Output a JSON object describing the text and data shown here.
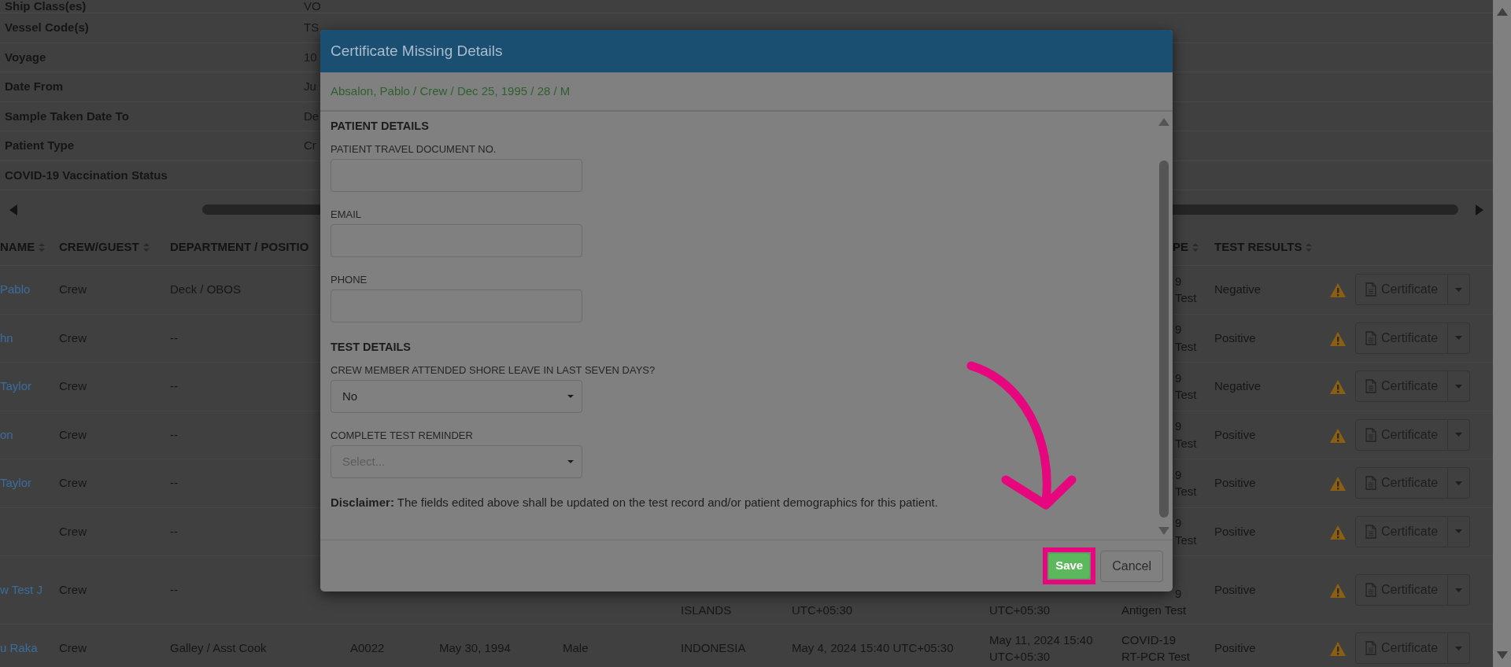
{
  "summary": [
    {
      "label": "Ship Class(es)",
      "value": "VO"
    },
    {
      "label": "Vessel Code(s)",
      "value": "TS"
    },
    {
      "label": "Voyage",
      "value": "10"
    },
    {
      "label": "Date From",
      "value": "Ju"
    },
    {
      "label": "Sample Taken Date To",
      "value": "De"
    },
    {
      "label": "Patient Type",
      "value": "Cr"
    },
    {
      "label": "COVID-19 Vaccination Status"
    }
  ],
  "table": {
    "columns": [
      {
        "label": "NAME",
        "sortable": true
      },
      {
        "label": "CREW/GUEST",
        "sortable": true
      },
      {
        "label": "DEPARTMENT / POSITIO",
        "sortable": false
      },
      {
        "label": "PE",
        "sortable": true
      },
      {
        "label": "TEST RESULTS",
        "sortable": true
      }
    ],
    "rows": [
      {
        "name": "Pablo",
        "crew_guest": "Crew",
        "department": "Deck / OBOS",
        "test_type": {
          "kind": "covered",
          "lines": [
            "9",
            "Test"
          ]
        },
        "test_results": "Negative",
        "button": "Certificate"
      },
      {
        "name": "hn",
        "crew_guest": "Crew",
        "department": "--",
        "test_type": {
          "kind": "covered",
          "lines": [
            "9",
            "Test"
          ]
        },
        "test_results": "Positive",
        "button": "Certificate"
      },
      {
        "name": "Taylor",
        "crew_guest": "Crew",
        "department": "--",
        "test_type": {
          "kind": "covered",
          "lines": [
            "9",
            "Test"
          ]
        },
        "test_results": "Negative",
        "button": "Certificate"
      },
      {
        "name": "on",
        "crew_guest": "Crew",
        "department": "--",
        "test_type": {
          "kind": "covered",
          "lines": [
            "9",
            "Test"
          ]
        },
        "test_results": "Positive",
        "button": "Certificate"
      },
      {
        "name": "Taylor",
        "crew_guest": "Crew",
        "department": "--",
        "test_type": {
          "kind": "covered",
          "lines": [
            "9",
            "Test"
          ]
        },
        "test_results": "Positive",
        "button": "Certificate"
      },
      {
        "crew_guest": "Crew",
        "department": "--",
        "test_type": {
          "kind": "covered",
          "lines": [
            "9",
            "Test"
          ]
        },
        "test_results": "Positive",
        "button": "Certificate"
      },
      {
        "kind": "partly_covered",
        "name": "w Test J",
        "crew_guest": "Crew",
        "department": "--",
        "column_7": "ISLANDS",
        "column_8": "UTC+05:30",
        "column_9": "UTC+05:30",
        "test_type": {
          "kind": "first_line_covered",
          "lines": [
            "9",
            "Antigen Test"
          ]
        },
        "test_results": "Positive",
        "button": "Certificate"
      },
      {
        "name": "u Raka",
        "crew_guest": "Crew",
        "department": "Galley / Asst Cook",
        "column_4": "A0022",
        "column_5": "May 30, 1994",
        "column_6": "Male",
        "column_7": "INDONESIA",
        "column_8": "May 4, 2024 15:40 UTC+05:30",
        "column_9": "May 11, 2024 15:40 UTC+05:30",
        "test_type": {
          "kind": "whole",
          "lines": [
            "COVID-19",
            "RT-PCR Test"
          ]
        },
        "test_results": "Positive",
        "button": "Certificate"
      }
    ]
  },
  "modal": {
    "title": "Certificate Missing Details",
    "patient_summary": "Absalon, Pablo / Crew / Dec 25, 1995 / 28 / M",
    "sections": [
      {
        "heading": "PATIENT DETAILS",
        "fields": [
          {
            "kind": "text",
            "label": "PATIENT TRAVEL DOCUMENT NO."
          },
          {
            "kind": "text",
            "label": "EMAIL"
          },
          {
            "kind": "text",
            "label": "PHONE"
          }
        ]
      },
      {
        "heading": "TEST DETAILS",
        "fields": [
          {
            "kind": "select",
            "label": "CREW MEMBER ATTENDED SHORE LEAVE IN LAST SEVEN DAYS?",
            "value": "No"
          },
          {
            "kind": "select",
            "label": "COMPLETE TEST REMINDER",
            "placeholder": "Select..."
          }
        ]
      }
    ],
    "disclaimer": "**Disclaimer:** The fields edited above shall be updated on the test record and/or patient demographics for this patient.",
    "buttons": [
      {
        "kind": "primary",
        "label": "Save",
        "highlighted": true
      },
      {
        "kind": "default",
        "label": "Cancel",
        "highlighted": false
      }
    ]
  }
}
